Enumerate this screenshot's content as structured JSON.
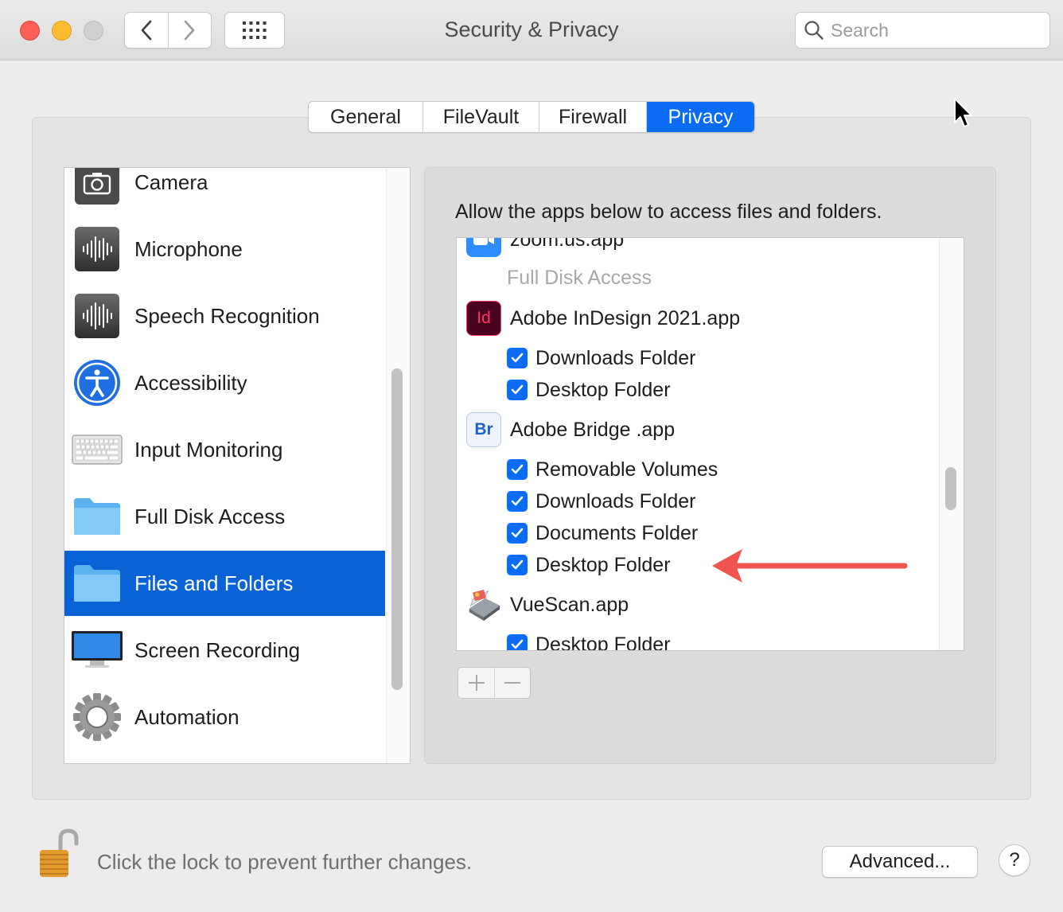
{
  "window": {
    "title": "Security & Privacy",
    "search_placeholder": "Search"
  },
  "tabs": [
    {
      "label": "General",
      "active": false
    },
    {
      "label": "FileVault",
      "active": false
    },
    {
      "label": "Firewall",
      "active": false
    },
    {
      "label": "Privacy",
      "active": true
    }
  ],
  "sidebar": {
    "items": [
      {
        "label": "Camera",
        "icon": "camera-icon"
      },
      {
        "label": "Microphone",
        "icon": "microphone-icon"
      },
      {
        "label": "Speech Recognition",
        "icon": "speech-recognition-icon"
      },
      {
        "label": "Accessibility",
        "icon": "accessibility-icon"
      },
      {
        "label": "Input Monitoring",
        "icon": "keyboard-icon"
      },
      {
        "label": "Full Disk Access",
        "icon": "folder-icon"
      },
      {
        "label": "Files and Folders",
        "icon": "folder-icon",
        "selected": true
      },
      {
        "label": "Screen Recording",
        "icon": "display-icon"
      },
      {
        "label": "Automation",
        "icon": "gear-icon"
      }
    ]
  },
  "panel": {
    "description": "Allow the apps below to access files and folders.",
    "apps": {
      "zoom": {
        "name": "zoom.us.app"
      },
      "group_header": "Full Disk Access",
      "indesign": {
        "name": "Adobe InDesign 2021.app",
        "icon_text": "Id",
        "folders": [
          "Downloads Folder",
          "Desktop Folder"
        ]
      },
      "bridge": {
        "name": "Adobe Bridge .app",
        "icon_text": "Br",
        "folders": [
          "Removable Volumes",
          "Downloads Folder",
          "Documents Folder",
          "Desktop Folder"
        ]
      },
      "vuescan": {
        "name": "VueScan.app",
        "folders": [
          "Desktop Folder"
        ]
      }
    },
    "add_label": "+",
    "remove_label": "−"
  },
  "footer": {
    "lock_text": "Click the lock to prevent further changes.",
    "advanced_label": "Advanced...",
    "help_label": "?"
  },
  "colors": {
    "accent": "#0a6cf5",
    "selection": "#0a63d6",
    "annotation_arrow": "#f0544f"
  }
}
